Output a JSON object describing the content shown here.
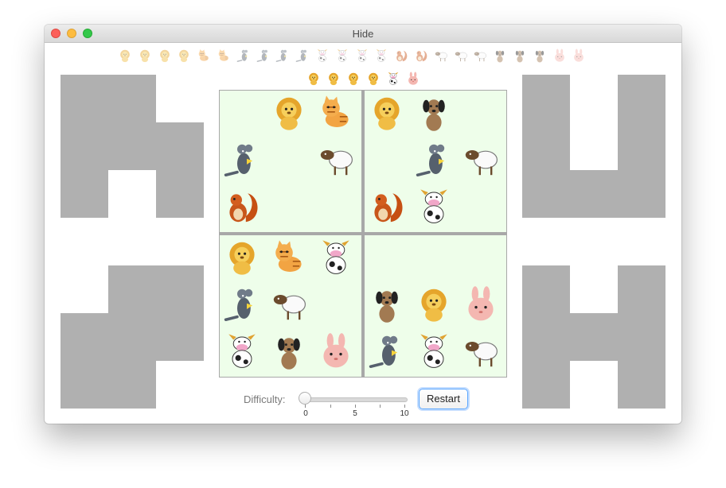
{
  "window": {
    "title": "Hide"
  },
  "palette": {
    "shape_gray": "#b0b0b0",
    "board_bg": "#eefeea",
    "board_border": "#a8a8a8",
    "accent": "#5aa6ff"
  },
  "top_strip": {
    "animals": [
      "lion",
      "lion",
      "lion",
      "lion",
      "cat",
      "cat",
      "mouse",
      "mouse",
      "mouse",
      "mouse",
      "cow",
      "cow",
      "cow",
      "cow",
      "squirrel",
      "squirrel",
      "sheep",
      "sheep",
      "sheep",
      "dog",
      "dog",
      "dog",
      "rabbit",
      "rabbit"
    ]
  },
  "selected_row": {
    "animals": [
      "lion",
      "lion",
      "lion",
      "lion",
      "cow",
      "rabbit"
    ]
  },
  "board": {
    "quadrants": [
      {
        "name": "top-left",
        "grid": [
          [
            null,
            "lion",
            "cat"
          ],
          [
            "mouse",
            null,
            "sheep"
          ],
          [
            "squirrel",
            null,
            null
          ]
        ]
      },
      {
        "name": "top-right",
        "grid": [
          [
            "lion",
            "dog",
            null
          ],
          [
            null,
            "mouse",
            "sheep"
          ],
          [
            "squirrel",
            "cow",
            null
          ]
        ]
      },
      {
        "name": "bottom-left",
        "grid": [
          [
            "lion",
            "cat",
            "cow"
          ],
          [
            "mouse",
            "sheep",
            null
          ],
          [
            "cow",
            "dog",
            "rabbit"
          ]
        ]
      },
      {
        "name": "bottom-right",
        "grid": [
          [
            null,
            null,
            null
          ],
          [
            "dog",
            "lion",
            "rabbit"
          ],
          [
            "mouse",
            "cow",
            "sheep"
          ]
        ]
      }
    ]
  },
  "controls": {
    "difficulty_label": "Difficulty:",
    "difficulty_value": 0,
    "difficulty_min": 0,
    "difficulty_max": 10,
    "tick_labels": [
      "0",
      "5",
      "10"
    ],
    "restart_label": "Restart"
  }
}
